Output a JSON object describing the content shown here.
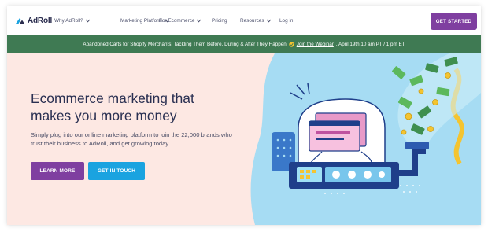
{
  "nav": {
    "logo_text": "AdRoll",
    "items": [
      {
        "label": "Why AdRoll?",
        "dropdown": true
      },
      {
        "label": "Marketing Platform",
        "dropdown": true
      },
      {
        "label": "For Ecommerce",
        "dropdown": true
      },
      {
        "label": "Pricing",
        "dropdown": false
      },
      {
        "label": "Resources",
        "dropdown": true
      },
      {
        "label": "Log in",
        "dropdown": false
      }
    ],
    "cta_label": "GET STARTED"
  },
  "banner": {
    "text": "Abandoned Carts for Shopify Merchants: Tackling Them Before, During & After They Happen",
    "link_text": "Join the Webinar",
    "date_text": ", April 19th 10 am PT / 1 pm ET"
  },
  "hero": {
    "headline": "Ecommerce marketing that makes you more money",
    "subtext": "Simply plug into our online marketing platform to join the 22,000 brands who trust their business to AdRoll, and get growing today.",
    "primary_button": "LEARN MORE",
    "secondary_button": "GET IN TOUCH"
  },
  "colors": {
    "brand_purple": "#7f3fa0",
    "brand_blue": "#1aa3e0",
    "banner_green": "#3f7a53",
    "hero_pink": "#fde8e3",
    "illustration_blue": "#a6dcf3",
    "navy": "#2a3052"
  }
}
